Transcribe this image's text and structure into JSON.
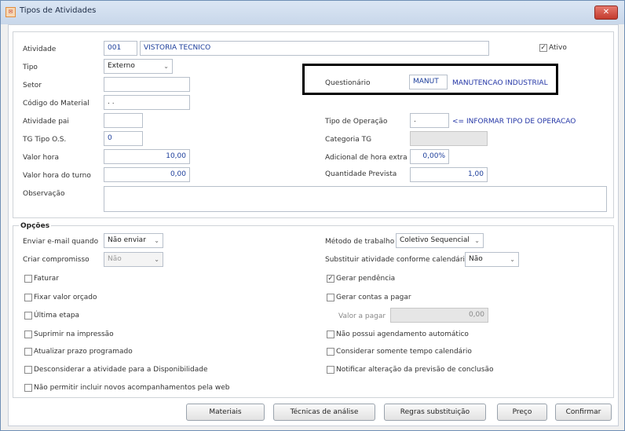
{
  "window": {
    "title": "Tipos de Atividades",
    "close_label": "✕",
    "app_icon": "app-icon"
  },
  "atividade": {
    "label": "Atividade",
    "code": "001",
    "name": "VISTORIA TECNICO"
  },
  "ativo": {
    "label": "Ativo",
    "checked": true
  },
  "tipo": {
    "label": "Tipo",
    "value": "Externo"
  },
  "setor": {
    "label": "Setor",
    "value": ""
  },
  "codigo_material": {
    "label": "Código do Material",
    "value": ". ."
  },
  "atividade_pai": {
    "label": "Atividade pai",
    "value": ""
  },
  "tg_tipo_os": {
    "label": "TG Tipo O.S.",
    "value": "0"
  },
  "valor_hora": {
    "label": "Valor hora",
    "value": "10,00"
  },
  "valor_hora_turno": {
    "label": "Valor hora do turno",
    "value": "0,00"
  },
  "observacao": {
    "label": "Observação",
    "value": ""
  },
  "questionario": {
    "label": "Questionário",
    "code": "MANUT",
    "name": "MANUTENCAO INDUSTRIAL"
  },
  "tipo_operacao": {
    "label": "Tipo de Operação",
    "value": ".",
    "hint": "<= INFORMAR TIPO DE OPERACAO"
  },
  "categoria_tg": {
    "label": "Categoria TG",
    "value": ""
  },
  "adicional_hora_extra": {
    "label": "Adicional de hora extra",
    "value": "0,00%"
  },
  "quantidade_prevista": {
    "label": "Quantidade Prevista",
    "value": "1,00"
  },
  "opcoes": {
    "title": "Opções",
    "enviar_email": {
      "label": "Enviar e-mail quando",
      "value": "Não enviar"
    },
    "criar_compromisso": {
      "label": "Criar compromisso",
      "value": "Não"
    },
    "metodo_trabalho": {
      "label": "Método de trabalho",
      "value": "Coletivo Sequencial"
    },
    "substituir_atividade": {
      "label": "Substituir atividade conforme calendário",
      "value": "Não"
    },
    "left_checks": [
      {
        "label": "Faturar",
        "checked": false
      },
      {
        "label": "Fixar valor orçado",
        "checked": false
      },
      {
        "label": "Última etapa",
        "checked": false
      },
      {
        "label": "Suprimir na impressão",
        "checked": false
      },
      {
        "label": "Atualizar prazo programado",
        "checked": false
      },
      {
        "label": "Desconsiderar a atividade para a Disponibilidade",
        "checked": false
      },
      {
        "label": "Não permitir incluir novos acompanhamentos pela web",
        "checked": false
      }
    ],
    "right_checks": [
      {
        "label": "Gerar pendência",
        "checked": true
      },
      {
        "label": "Gerar contas a pagar",
        "checked": false
      },
      {
        "label": "Não possui agendamento automático",
        "checked": false
      },
      {
        "label": "Considerar somente tempo calendário",
        "checked": false
      },
      {
        "label": "Notificar alteração da previsão de conclusão",
        "checked": false
      }
    ],
    "valor_a_pagar": {
      "label": "Valor a pagar",
      "value": "0,00"
    }
  },
  "buttons": {
    "materiais": "Materiais",
    "tecnicas": "Técnicas de análise",
    "regras": "Regras substituição",
    "preco": "Preço",
    "confirmar": "Confirmar"
  }
}
